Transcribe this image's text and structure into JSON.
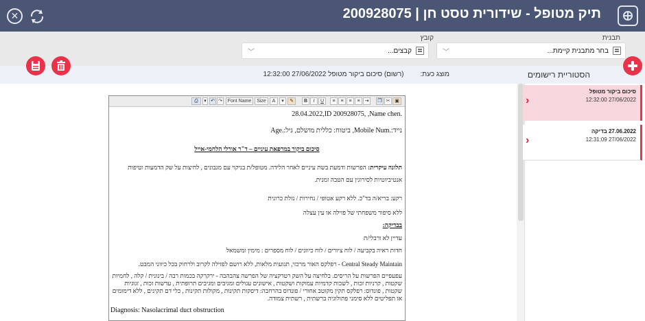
{
  "header": {
    "title": "תיק מטופל - שידורית טסט חן | 200928075"
  },
  "filters": {
    "template": {
      "label": "תבנית",
      "value": "בחר מתבנית קיימת..."
    },
    "file": {
      "label": "קובץ",
      "value": "קבצים..."
    }
  },
  "history": {
    "title": "הסטוריית רישומים",
    "shown_label": "מוצג כעת:",
    "shown_value": "(רשום) סיכום ביקור מטופל 27/06/2022 12:32:00"
  },
  "records": [
    {
      "name": "סיכום ביקור מטופל",
      "datetime": "27/06/2022 12:32:00"
    },
    {
      "name": "27.06.2022 בדיקה",
      "datetime": "27/06/2022 12:31:09"
    }
  ],
  "toolbar": {
    "font_name": "Font Name",
    "size": "Size",
    "bold": "B",
    "italic": "I",
    "underline": "U"
  },
  "document": {
    "line1": "28.04.2022,ID 200928075, ,Name chen.",
    "line2": "נייד:.Mobile Num, ביטוח: כללית מושלם, גיל:.Age",
    "heading": "סיכום ביקור במרפאת עיניים – ד\"ר אורלי הלחמי-אייל",
    "complaint_label": "תלונה עיקרית:",
    "complaint_text": "הפרשות ודמעת בשת עיניים לאחר הלידה. מטופל/ת בניקוי עם מגבונים , לחיצות על שק הדמעות וטיפות",
    "complaint_cont": "אנטיביוטיות לסירוגין עם הטבה זמנית.",
    "background": "רקע: בריא/ה בד\"כ. ללא רקע אטופי / נחירות / נזלת כרונית",
    "family": "ללא סיפור משפחתי של פזילה או עין עצלה",
    "exam_label": "בבדיקה:",
    "line_a": "עדיין לא ורבלי/ת",
    "line_b": "חדות ראיה בקביעה / לוח ציורים / לוח כיוונים / לוח מספרים : מימין   ומשמאל",
    "line_c": "Central Steady Maintain - רפלקס האור מרכזי, תנועות מלאות, ללא רושם לפזילה לקרוב ולרחוק בכל כיווני המבט.",
    "para": "עפעפיים הפרשות על הריסים. בלחיצה על השק רטרקציה של הפרשה צהבהבה - ירקרקה בכמות רבה / בינונית / קלה , לחמיות שקטות , קרניות זכות , לשכות קדמיות עמוקות ושקטות , אישונים עגולים ומגיבים ומגיבים תרופתית , עדשות זכות , זגוגיות שקטות , פונדוס: רפלקס תקין מקוטב אחורי / פונדוס בהרחבה: דיסקות תקינות , מקולות תקינות , כלי דם תקינים , ללא דימומים או תפליטים ללא סימני פתולוגיה ברשתית , רשתית צמודה.",
    "diagnosis": "Diagnosis: Nasolacrimal duct obstruction"
  },
  "colors": {
    "header_bg": "#4a5674",
    "accent_red": "#e8334a",
    "selected_record_bg": "#f8d7dc",
    "history_bar_bg": "#ebf1f7"
  },
  "icons": {
    "close": "close-icon",
    "refresh": "refresh-icon",
    "app": "app-icon",
    "add": "plus-icon",
    "save": "save-icon",
    "delete": "trash-icon"
  }
}
